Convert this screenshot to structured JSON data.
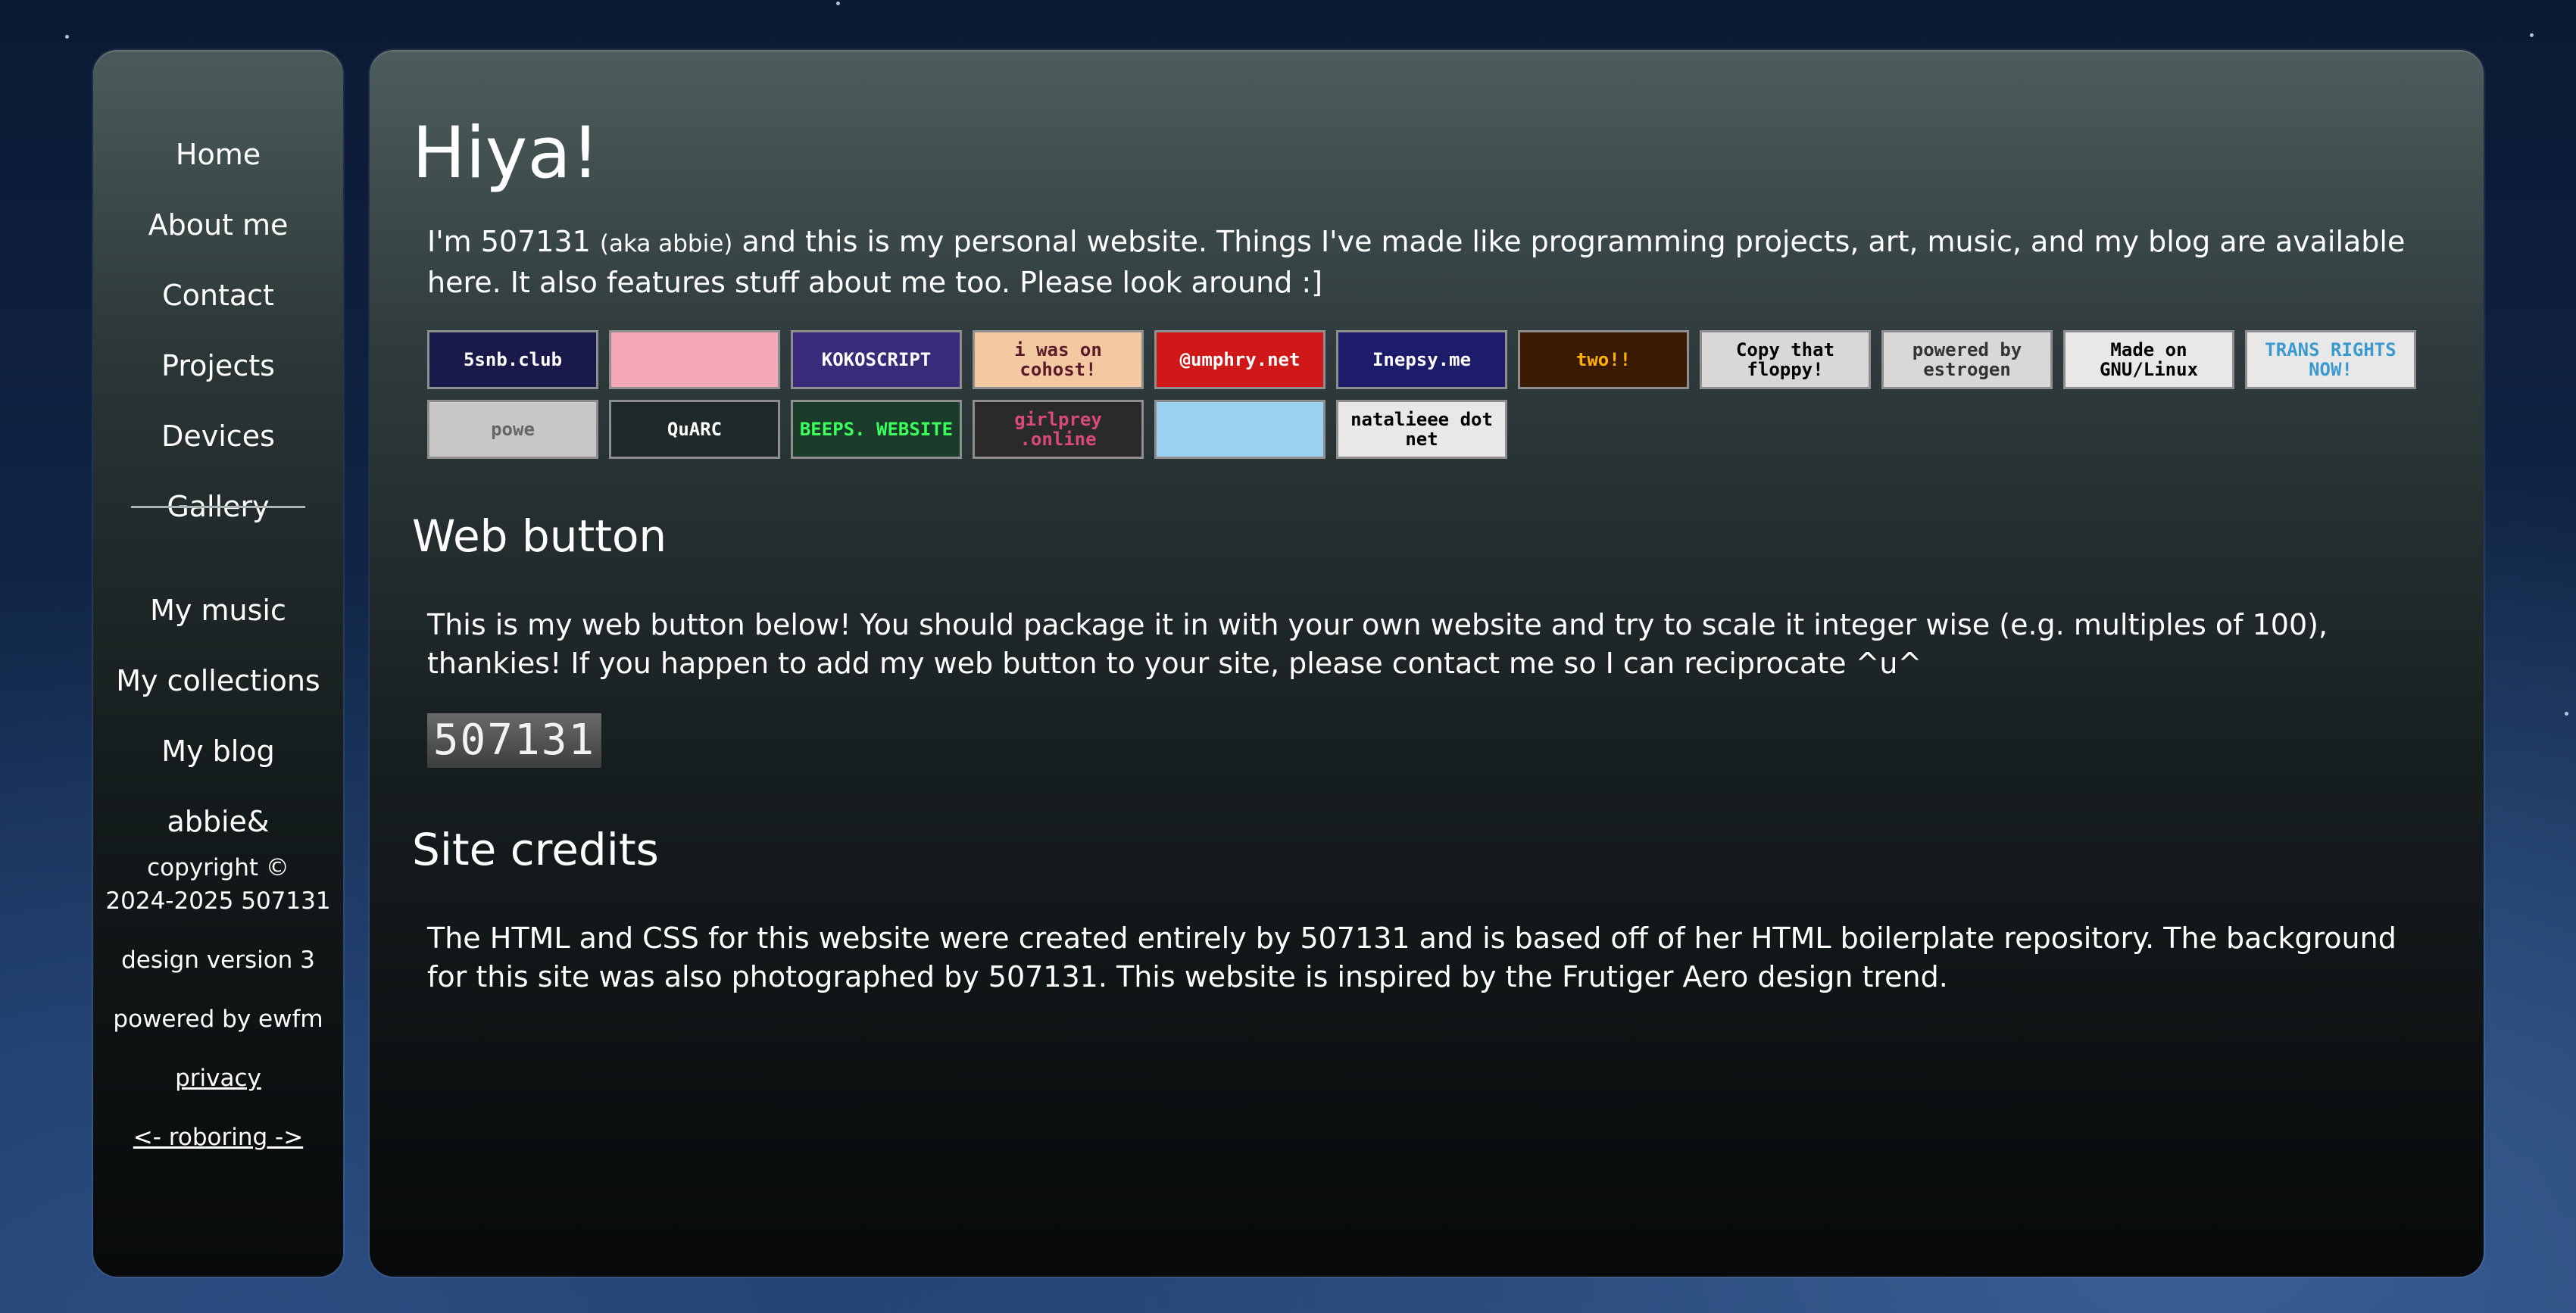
{
  "nav": {
    "home": "Home",
    "about": "About me",
    "contact": "Contact",
    "projects": "Projects",
    "devices": "Devices",
    "gallery": "Gallery",
    "music": "My music",
    "collections": "My collections",
    "blog": "My blog",
    "abbie": "abbie&"
  },
  "sidebar_footer": {
    "copyright_line1": "copyright ©",
    "copyright_line2": "2024-2025 507131",
    "design_version": "design version 3",
    "powered_by": "powered by ewfm",
    "privacy": "privacy",
    "webring": "<- roboring ->"
  },
  "main": {
    "title": "Hiya!",
    "intro_before": "I'm 507131 ",
    "intro_aka": "(aka abbie)",
    "intro_after": " and this is my personal website. Things I've made like programming projects, art, music, and my blog are available here. It also features stuff about me too. Please look around :]",
    "web_button_heading": "Web button",
    "web_button_text": "This is my web button below! You should package it in with your own website and try to scale it integer wise (e.g. multiples of 100), thankies! If you happen to add my web button to your site, please contact me so I can reciprocate ^u^",
    "web_button_label": "507131",
    "credits_heading": "Site credits",
    "credits_text": "The HTML and CSS for this website were created entirely by 507131 and is based off of her HTML boilerplate repository. The background for this site was also photographed by 507131. This website is inspired by the Frutiger Aero design trend."
  },
  "badges": [
    {
      "text": "5snb.club",
      "bg": "#1a1a4a",
      "fg": "#ffffff"
    },
    {
      "text": "",
      "bg": "#f5a9b8",
      "fg": "#000000"
    },
    {
      "text": "KOKOSCRIPT",
      "bg": "#3a2a7a",
      "fg": "#ffffff"
    },
    {
      "text": "i was on cohost!",
      "bg": "#f2c9a0",
      "fg": "#5a1a2a"
    },
    {
      "text": "@umphry.net",
      "bg": "#d01818",
      "fg": "#ffffff"
    },
    {
      "text": "Inepsy.me",
      "bg": "#1c1c6a",
      "fg": "#ffffff"
    },
    {
      "text": "two!!",
      "bg": "#3a1a00",
      "fg": "#ffb300"
    },
    {
      "text": "Copy that floppy!",
      "bg": "#d8d8d8",
      "fg": "#000000"
    },
    {
      "text": "powered by estrogen",
      "bg": "#d8d8d8",
      "fg": "#333333"
    },
    {
      "text": "Made on GNU/Linux",
      "bg": "#e8e8e8",
      "fg": "#000000"
    },
    {
      "text": "TRANS RIGHTS NOW!",
      "bg": "#e8e8e8",
      "fg": "#3a9ad0"
    },
    {
      "text": "powe",
      "bg": "#c8c8c8",
      "fg": "#666666"
    },
    {
      "text": "QuARC",
      "bg": "#1e2a2a",
      "fg": "#ffffff"
    },
    {
      "text": "BEEPS. WEBSITE",
      "bg": "#1a3a2a",
      "fg": "#3aff5a"
    },
    {
      "text": "girlprey .online",
      "bg": "#2a2a2a",
      "fg": "#d84a7a"
    },
    {
      "text": "",
      "bg": "#9ad0f0",
      "fg": "#000000"
    },
    {
      "text": "natalieee dot net",
      "bg": "#e8e8e8",
      "fg": "#000000"
    }
  ]
}
